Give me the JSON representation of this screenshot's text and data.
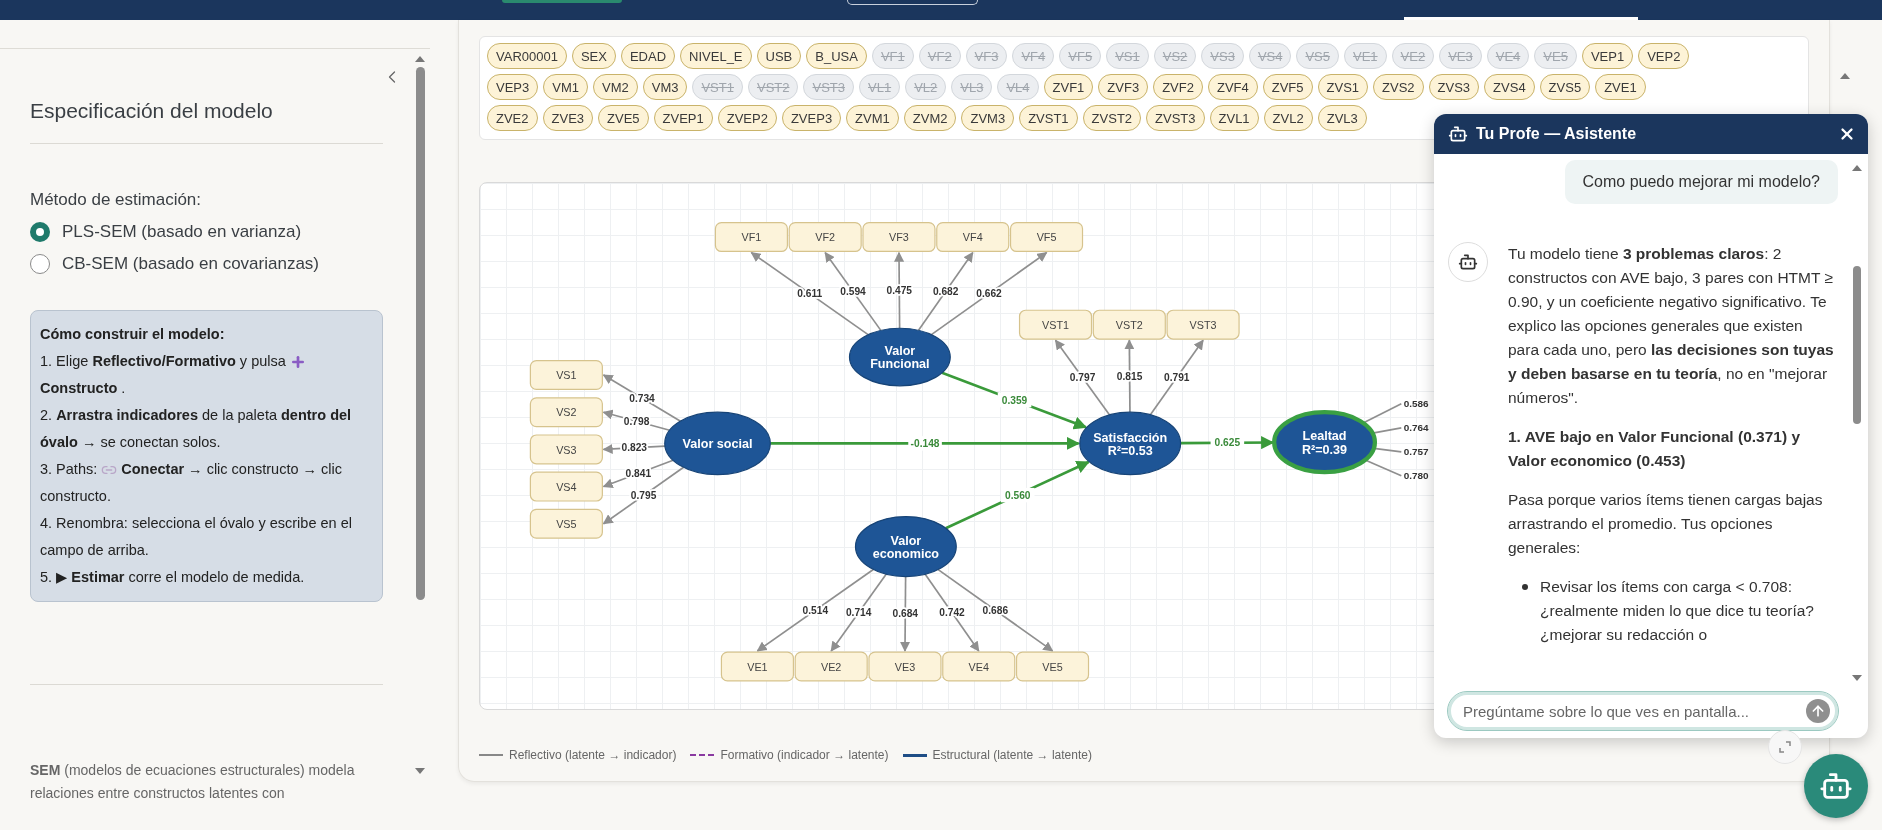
{
  "sidebar": {
    "title": "Especificación del modelo",
    "method_label": "Método de estimación:",
    "methods": [
      {
        "label": "PLS-SEM (basado en varianza)",
        "selected": true
      },
      {
        "label": "CB-SEM (basado en covarianzas)",
        "selected": false
      }
    ],
    "guide": {
      "title": "Cómo construir el modelo:",
      "steps": [
        {
          "text": "1. Elige **Reflectivo/Formativo** y pulsa",
          "after": "**Constructo** ."
        },
        {
          "text": "2. **Arrastra indicadores** de la paleta **dentro del óvalo** → se conectan solos."
        },
        {
          "text": "3. Paths:",
          "after": "**Conectar** → clic constructo → clic constructo."
        },
        {
          "text": "4. Renombra: selecciona el óvalo y escribe en el campo de arriba."
        },
        {
          "text": "5. ▶ **Estimar** corre el modelo de medida."
        }
      ]
    },
    "about": "**SEM** (modelos de ecuaciones estructurales) modela relaciones entre constructos latentes con"
  },
  "palette": {
    "chips": [
      {
        "label": "VAR00001",
        "used": false
      },
      {
        "label": "SEX",
        "used": false
      },
      {
        "label": "EDAD",
        "used": false
      },
      {
        "label": "NIVEL_E",
        "used": false
      },
      {
        "label": "USB",
        "used": false
      },
      {
        "label": "B_USA",
        "used": false
      },
      {
        "label": "VF1",
        "used": true
      },
      {
        "label": "VF2",
        "used": true
      },
      {
        "label": "VF3",
        "used": true
      },
      {
        "label": "VF4",
        "used": true
      },
      {
        "label": "VF5",
        "used": true
      },
      {
        "label": "VS1",
        "used": true
      },
      {
        "label": "VS2",
        "used": true
      },
      {
        "label": "VS3",
        "used": true
      },
      {
        "label": "VS4",
        "used": true
      },
      {
        "label": "VS5",
        "used": true
      },
      {
        "label": "VE1",
        "used": true
      },
      {
        "label": "VE2",
        "used": true
      },
      {
        "label": "VE3",
        "used": true
      },
      {
        "label": "VE4",
        "used": true
      },
      {
        "label": "VE5",
        "used": true
      },
      {
        "label": "VEP1",
        "used": false
      },
      {
        "label": "VEP2",
        "used": false
      },
      {
        "label": "VEP3",
        "used": false
      },
      {
        "label": "VM1",
        "used": false
      },
      {
        "label": "VM2",
        "used": false
      },
      {
        "label": "VM3",
        "used": false
      },
      {
        "label": "VST1",
        "used": true
      },
      {
        "label": "VST2",
        "used": true
      },
      {
        "label": "VST3",
        "used": true
      },
      {
        "label": "VL1",
        "used": true
      },
      {
        "label": "VL2",
        "used": true
      },
      {
        "label": "VL3",
        "used": true
      },
      {
        "label": "VL4",
        "used": true
      },
      {
        "label": "ZVF1",
        "used": false
      },
      {
        "label": "ZVF3",
        "used": false
      },
      {
        "label": "ZVF2",
        "used": false
      },
      {
        "label": "ZVF4",
        "used": false
      },
      {
        "label": "ZVF5",
        "used": false
      },
      {
        "label": "ZVS1",
        "used": false
      },
      {
        "label": "ZVS2",
        "used": false
      },
      {
        "label": "ZVS3",
        "used": false
      },
      {
        "label": "ZVS4",
        "used": false
      },
      {
        "label": "ZVS5",
        "used": false
      },
      {
        "label": "ZVE1",
        "used": false
      },
      {
        "label": "ZVE2",
        "used": false
      },
      {
        "label": "ZVE3",
        "used": false
      },
      {
        "label": "ZVE5",
        "used": false
      },
      {
        "label": "ZVEP1",
        "used": false
      },
      {
        "label": "ZVEP2",
        "used": false
      },
      {
        "label": "ZVEP3",
        "used": false
      },
      {
        "label": "ZVM1",
        "used": false
      },
      {
        "label": "ZVM2",
        "used": false
      },
      {
        "label": "ZVM3",
        "used": false
      },
      {
        "label": "ZVST1",
        "used": false
      },
      {
        "label": "ZVST2",
        "used": false
      },
      {
        "label": "ZVST3",
        "used": false
      },
      {
        "label": "ZVL1",
        "used": false
      },
      {
        "label": "ZVL2",
        "used": false
      },
      {
        "label": "ZVL3",
        "used": false
      }
    ]
  },
  "diagram": {
    "constructs": [
      {
        "name_lines": [
          "Valor",
          "Funcional"
        ],
        "selected": false,
        "indicators": [
          {
            "label": "VF1",
            "loading": "0.611"
          },
          {
            "label": "VF2",
            "loading": "0.594"
          },
          {
            "label": "VF3",
            "loading": "0.475"
          },
          {
            "label": "VF4",
            "loading": "0.682"
          },
          {
            "label": "VF5",
            "loading": "0.662"
          }
        ]
      },
      {
        "name_lines": [
          "Valor social"
        ],
        "selected": false,
        "indicators": [
          {
            "label": "VS1",
            "loading": "0.734"
          },
          {
            "label": "VS2",
            "loading": "0.798"
          },
          {
            "label": "VS3",
            "loading": "0.823"
          },
          {
            "label": "VS4",
            "loading": "0.841"
          },
          {
            "label": "VS5",
            "loading": "0.795"
          }
        ]
      },
      {
        "name_lines": [
          "Valor",
          "economico"
        ],
        "selected": false,
        "indicators": [
          {
            "label": "VE1",
            "loading": "0.514"
          },
          {
            "label": "VE2",
            "loading": "0.714"
          },
          {
            "label": "VE3",
            "loading": "0.684"
          },
          {
            "label": "VE4",
            "loading": "0.742"
          },
          {
            "label": "VE5",
            "loading": "0.686"
          }
        ]
      },
      {
        "name_lines": [
          "Satisfacción"
        ],
        "r2": "R²=0.53",
        "selected": false,
        "indicators": [
          {
            "label": "VST1",
            "loading": "0.797"
          },
          {
            "label": "VST2",
            "loading": "0.815"
          },
          {
            "label": "VST3",
            "loading": "0.791"
          }
        ]
      },
      {
        "name_lines": [
          "Lealtad"
        ],
        "r2": "R²=0.39",
        "selected": true,
        "indicators": [
          {
            "loading": "0.586"
          },
          {
            "loading": "0.764"
          },
          {
            "loading": "0.757"
          },
          {
            "loading": "0.780"
          }
        ]
      }
    ],
    "paths": [
      {
        "coefficient": "0.359"
      },
      {
        "coefficient": "-0.148"
      },
      {
        "coefficient": "0.560"
      },
      {
        "coefficient": "0.625"
      }
    ]
  },
  "legend": [
    {
      "kind": "reflective",
      "label": "Reflectivo (latente → indicador)"
    },
    {
      "kind": "formative",
      "label": "Formativo (indicador → latente)"
    },
    {
      "kind": "structural",
      "label": "Estructural (latente → latente)"
    }
  ],
  "chat": {
    "title": "Tu Profe — Asistente",
    "user_message": "Como puedo mejorar mi modelo?",
    "reply": [
      {
        "kind": "paragraph",
        "text": "Tu modelo tiene **3 problemas claros**: 2 constructos con AVE bajo, 3 pares con HTMT ≥ 0.90, y un coeficiente negativo significativo. Te explico las opciones generales que existen para cada uno, pero **las decisiones son tuyas y deben basarse en tu teoría**, no en \"mejorar números\"."
      },
      {
        "kind": "heading",
        "text": "1. AVE bajo en Valor Funcional (0.371) y Valor economico (0.453)"
      },
      {
        "kind": "paragraph",
        "text": "Pasa porque varios ítems tienen cargas bajas arrastrando el promedio. Tus opciones generales:"
      },
      {
        "kind": "bullet",
        "text": "Revisar los ítems con carga < 0.708: ¿realmente miden lo que dice tu teoría? ¿mejorar su redacción o"
      }
    ],
    "input_placeholder": "Pregúntame sobre lo que ves en pantalla..."
  }
}
